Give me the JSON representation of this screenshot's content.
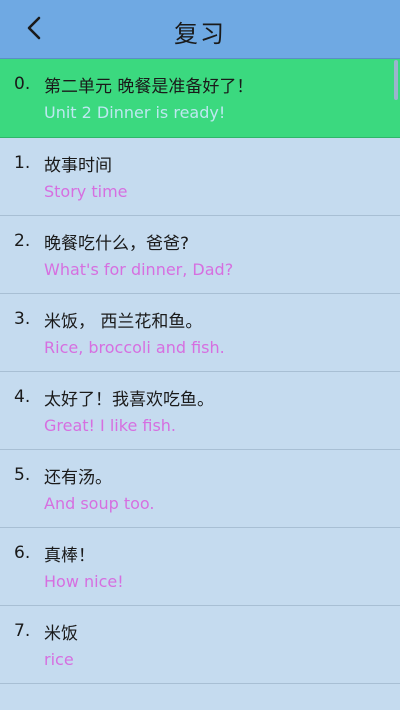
{
  "header": {
    "title": "复习",
    "back_icon": "chevron-left-icon"
  },
  "items": [
    {
      "num": "0.",
      "cn": "第二单元 晚餐是准备好了！",
      "en": "Unit 2 Dinner is ready!"
    },
    {
      "num": "1.",
      "cn": "故事时间",
      "en": "Story time"
    },
    {
      "num": "2.",
      "cn": "晚餐吃什么，爸爸?",
      "en": "What's for dinner, Dad?"
    },
    {
      "num": "3.",
      "cn": "米饭，  西兰花和鱼。",
      "en": "Rice, broccoli and fish."
    },
    {
      "num": "4.",
      "cn": "太好了！我喜欢吃鱼。",
      "en": "Great! I like fish."
    },
    {
      "num": "5.",
      "cn": "还有汤。",
      "en": "And soup too."
    },
    {
      "num": "6.",
      "cn": "真棒！",
      "en": "How nice!"
    },
    {
      "num": "7.",
      "cn": "米饭",
      "en": "rice"
    }
  ],
  "colors": {
    "header_bg": "#6fa9e3",
    "active_bg": "#3bd97f",
    "list_bg": "#c5dbef",
    "english_text": "#d66fe0"
  }
}
